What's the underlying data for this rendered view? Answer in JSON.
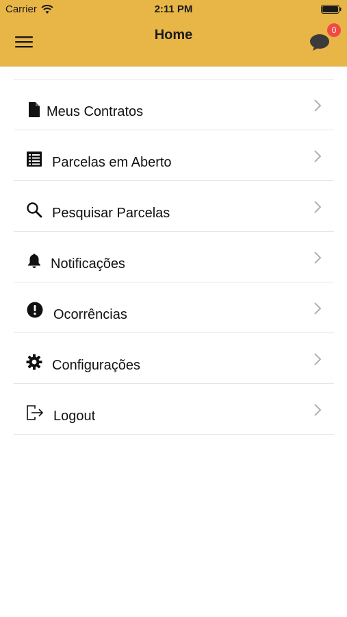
{
  "status_bar": {
    "carrier": "Carrier",
    "time": "2:11 PM"
  },
  "nav": {
    "title": "Home",
    "chat_badge_count": "0"
  },
  "colors": {
    "header_bg": "#e8b547",
    "badge_bg": "#f04a43",
    "divider": "#e4e4e4"
  },
  "menu": {
    "items": [
      {
        "label": "Meus Contratos",
        "icon": "document-icon"
      },
      {
        "label": "Parcelas em Aberto",
        "icon": "list-icon"
      },
      {
        "label": "Pesquisar Parcelas",
        "icon": "search-icon"
      },
      {
        "label": "Notificações",
        "icon": "bell-icon"
      },
      {
        "label": "Ocorrências",
        "icon": "alert-icon"
      },
      {
        "label": "Configurações",
        "icon": "gear-icon"
      },
      {
        "label": "Logout",
        "icon": "logout-icon"
      }
    ]
  }
}
